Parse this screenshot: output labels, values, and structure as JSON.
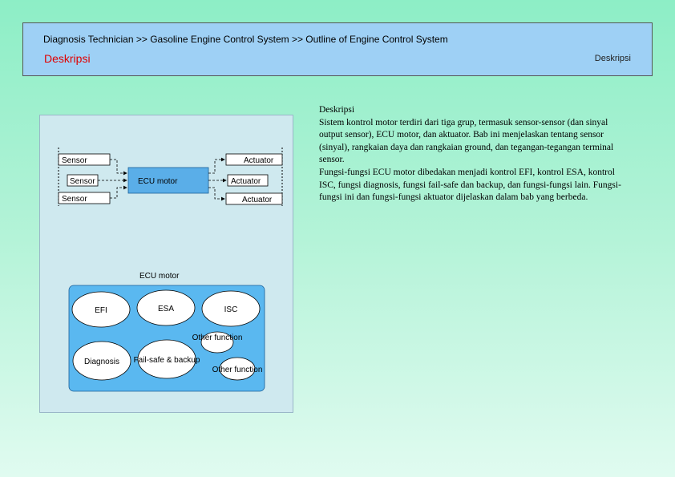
{
  "header": {
    "breadcrumb": "Diagnosis Technician >> Gasoline Engine Control System  >> Outline of Engine Control System",
    "title": "Deskripsi",
    "right_label": "Deskripsi"
  },
  "diagram": {
    "sensors": [
      "Sensor",
      "Sensor",
      "Sensor"
    ],
    "actuators": [
      "Actuator",
      "Actuator",
      "Actuator"
    ],
    "ecu_label": "ECU motor",
    "lower_title": "ECU motor",
    "functions": [
      "EFI",
      "ESA",
      "ISC",
      "Other function",
      "Diagnosis",
      "Fail-safe & backup",
      "Other function"
    ]
  },
  "description": {
    "heading": "Deskripsi",
    "paragraph1": "Sistem kontrol motor terdiri dari tiga grup, termasuk sensor-sensor (dan sinyal output sensor), ECU motor, dan aktuator. Bab ini menjelaskan tentang sensor (sinyal), rangkaian daya dan rangkaian ground, dan tegangan-tegangan terminal sensor.",
    "paragraph2": "Fungsi-fungsi ECU motor dibedakan menjadi kontrol EFI, kontrol ESA, kontrol ISC, fungsi diagnosis, fungsi fail-safe dan backup, dan fungsi-fungsi lain. Fungsi-fungsi ini dan fungsi-fungsi aktuator dijelaskan dalam bab yang berbeda."
  }
}
